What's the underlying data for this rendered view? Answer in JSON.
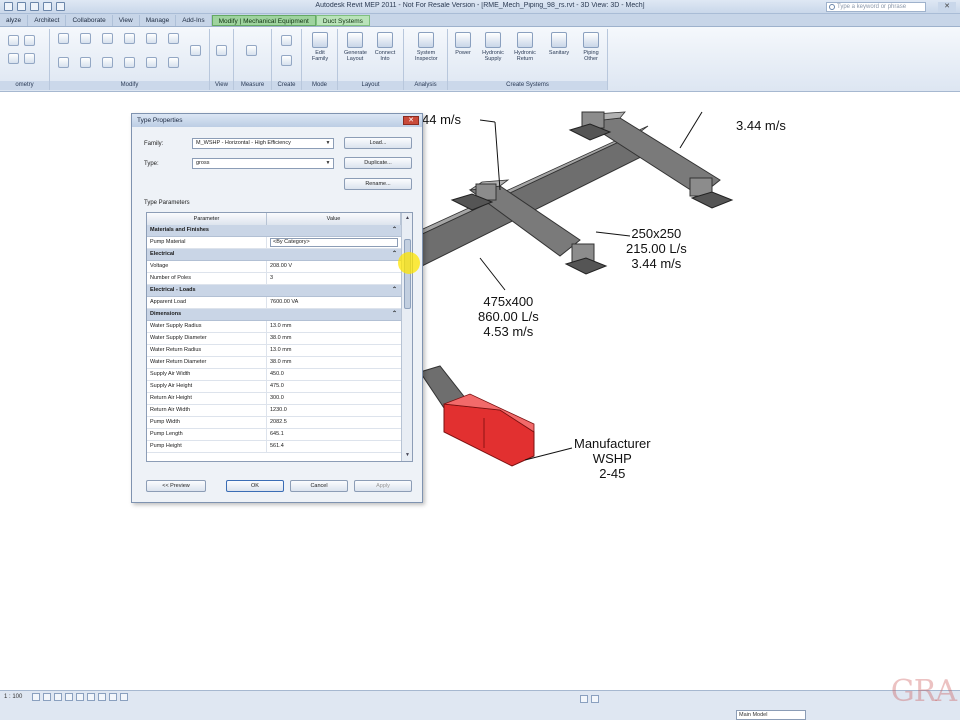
{
  "window": {
    "title": "Autodesk Revit MEP 2011 - Not For Resale Version - [RME_Mech_Piping_98_rs.rvt - 3D View: 3D - Mech]",
    "search_placeholder": "Type a keyword or phrase"
  },
  "tabs": [
    {
      "label": "alyze"
    },
    {
      "label": "Architect"
    },
    {
      "label": "Collaborate"
    },
    {
      "label": "View"
    },
    {
      "label": "Manage"
    },
    {
      "label": "Add-Ins"
    },
    {
      "label": "Modify | Mechanical Equipment",
      "context": true
    },
    {
      "label": "Duct Systems",
      "context2": true
    }
  ],
  "ribbon": {
    "panels": [
      "ometry",
      "Modify",
      "View",
      "Measure",
      "Create",
      "Mode",
      "Layout",
      "Analysis",
      "Create Systems"
    ],
    "buttons": {
      "edit_family": "Edit Family",
      "generate_layout": "Generate Layout",
      "connect_into": "Connect Into",
      "system_inspector": "System Inspector",
      "power": "Power",
      "hydronic_supply": "Hydronic Supply",
      "hydronic_return": "Hydronic Return",
      "sanitary": "Sanitary",
      "piping_other": "Piping Other"
    }
  },
  "drawing": {
    "tags": [
      {
        "lines": [
          "44 m/s"
        ]
      },
      {
        "lines": [
          "3.44 m/s"
        ]
      },
      {
        "lines": [
          "250x250",
          "215.00 L/s",
          "3.44 m/s"
        ]
      },
      {
        "lines": [
          "475x400",
          "860.00 L/s",
          "4.53 m/s"
        ]
      },
      {
        "lines": [
          "Manufacturer",
          "WSHP",
          "2-45"
        ]
      }
    ]
  },
  "dialog": {
    "title": "Type Properties",
    "family_label": "Family:",
    "family_value": "M_WSHP - Horizontal - High Efficiency",
    "type_label": "Type:",
    "type_value": "gross",
    "load_btn": "Load...",
    "duplicate_btn": "Duplicate...",
    "rename_btn": "Rename...",
    "type_params_label": "Type Parameters",
    "col_parameter": "Parameter",
    "col_value": "Value",
    "groups": [
      {
        "name": "Materials and Finishes",
        "rows": [
          {
            "param": "Pump Material",
            "value": "<By Category>",
            "picker": true
          }
        ]
      },
      {
        "name": "Electrical",
        "rows": [
          {
            "param": "Voltage",
            "value": "208.00 V"
          },
          {
            "param": "Number of Poles",
            "value": "3"
          }
        ]
      },
      {
        "name": "Electrical - Loads",
        "rows": [
          {
            "param": "Apparent Load",
            "value": "7600.00 VA"
          }
        ]
      },
      {
        "name": "Dimensions",
        "rows": [
          {
            "param": "Water Supply Radius",
            "value": "13.0 mm"
          },
          {
            "param": "Water Supply Diameter",
            "value": "38.0 mm"
          },
          {
            "param": "Water Return Radius",
            "value": "13.0 mm"
          },
          {
            "param": "Water Return Diameter",
            "value": "38.0 mm"
          },
          {
            "param": "Supply Air Width",
            "value": "450.0"
          },
          {
            "param": "Supply Air Height",
            "value": "475.0"
          },
          {
            "param": "Return Air Height",
            "value": "300.0"
          },
          {
            "param": "Return Air Width",
            "value": "1230.0"
          },
          {
            "param": "Pump Width",
            "value": "2082.5"
          },
          {
            "param": "Pump Length",
            "value": "645.1"
          },
          {
            "param": "Pump Height",
            "value": "561.4"
          }
        ]
      }
    ],
    "preview_btn": "<< Preview",
    "ok_btn": "OK",
    "cancel_btn": "Cancel",
    "apply_btn": "Apply"
  },
  "status": {
    "scale": "1 : 100",
    "model": "Main Model"
  },
  "watermark": "GRA"
}
